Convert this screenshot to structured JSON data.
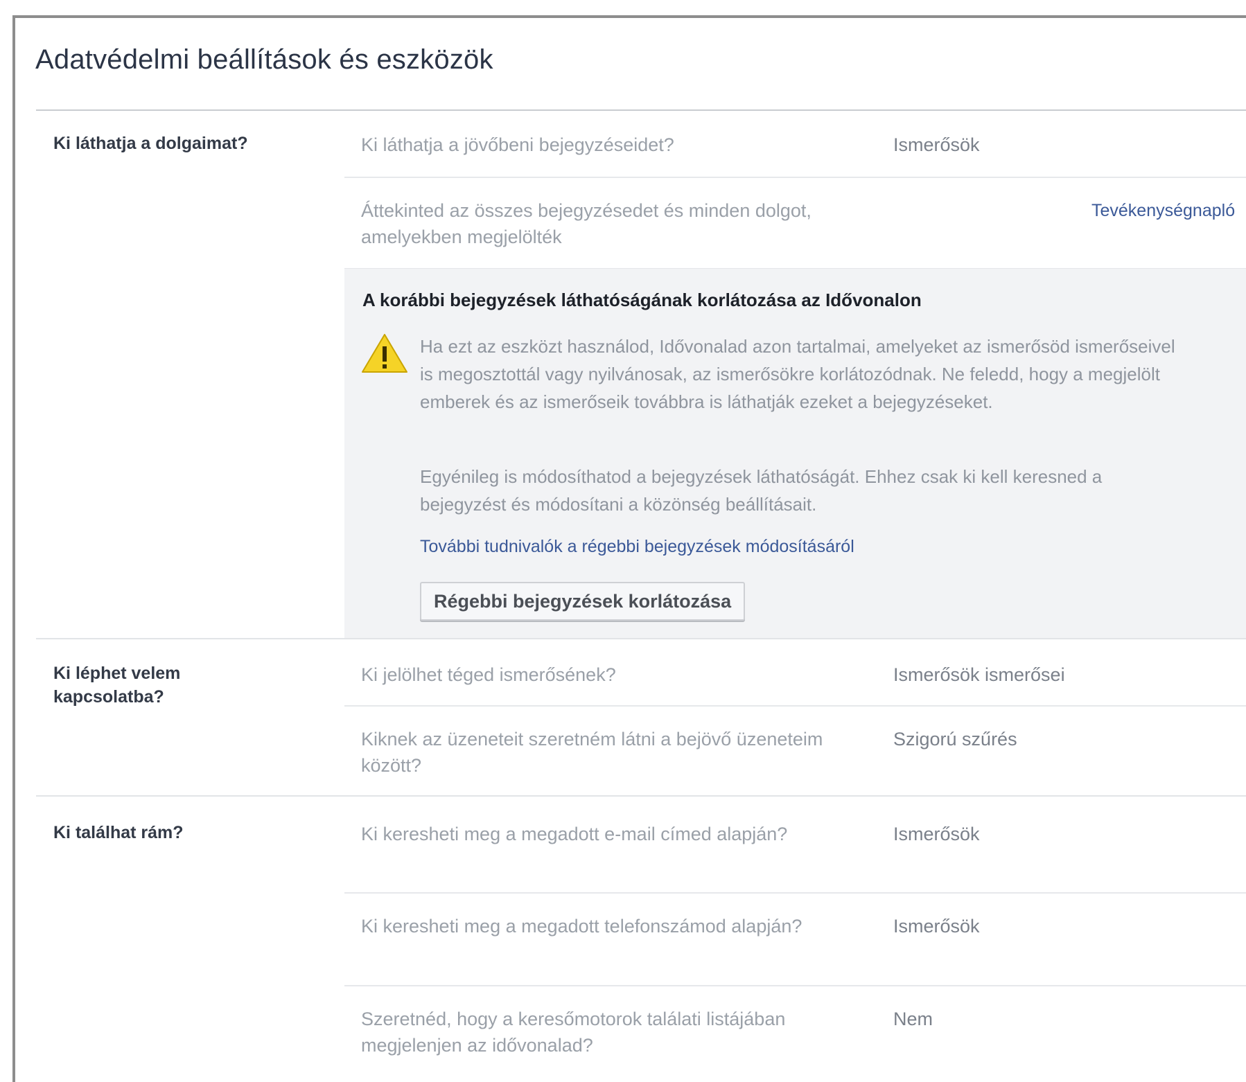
{
  "page": {
    "title": "Adatvédelmi beállítások és eszközök"
  },
  "sections": [
    {
      "label": "Ki láthatja a dolgaimat?",
      "rows": [
        {
          "question": "Ki láthatja a jövőbeni bejegyzéseidet?",
          "value": "Ismerősök"
        },
        {
          "question": "Áttekinted az összes bejegyzésedet és minden dolgot, amelyekben megjelölték",
          "value": "Tevékenységnapló"
        }
      ],
      "expanded": {
        "title": "A korábbi bejegyzések láthatóságának korlátozása az Idővonalon",
        "warning_icon": "warning-icon",
        "paragraph1": "Ha ezt az eszközt használod, Idővonalad azon tartalmai, amelyeket az ismerősöd ismerőseivel is megosztottál vagy nyilvánosak, az ismerősökre korlátozódnak. Ne feledd, hogy a megjelölt emberek és az ismerőseik továbbra is láthatják ezeket a bejegyzéseket.",
        "paragraph2": "Egyénileg is módosíthatod a bejegyzések láthatóságát. Ehhez csak ki kell keresned a bejegyzést és módosítani a közönség beállításait.",
        "link": "További tudnivalók a régebbi bejegyzések módosításáról",
        "button": "Régebbi bejegyzések korlátozása"
      }
    },
    {
      "label": "Ki léphet velem kapcsolatba?",
      "rows": [
        {
          "question": "Ki jelölhet téged ismerősének?",
          "value": "Ismerősök ismerősei"
        },
        {
          "question": "Kiknek az üzeneteit szeretném látni a bejövő üzeneteim között?",
          "value": "Szigorú szűrés"
        }
      ]
    },
    {
      "label": "Ki találhat rám?",
      "rows": [
        {
          "question": "Ki keresheti meg a megadott e-mail címed alapján?",
          "value": "Ismerősök"
        },
        {
          "question": "Ki keresheti meg a megadott telefonszámod alapján?",
          "value": "Ismerősök"
        },
        {
          "question": "Szeretnéd, hogy a keresőmotorok találati listájában megjelenjen az idővonalad?",
          "value": "Nem"
        }
      ]
    }
  ]
}
